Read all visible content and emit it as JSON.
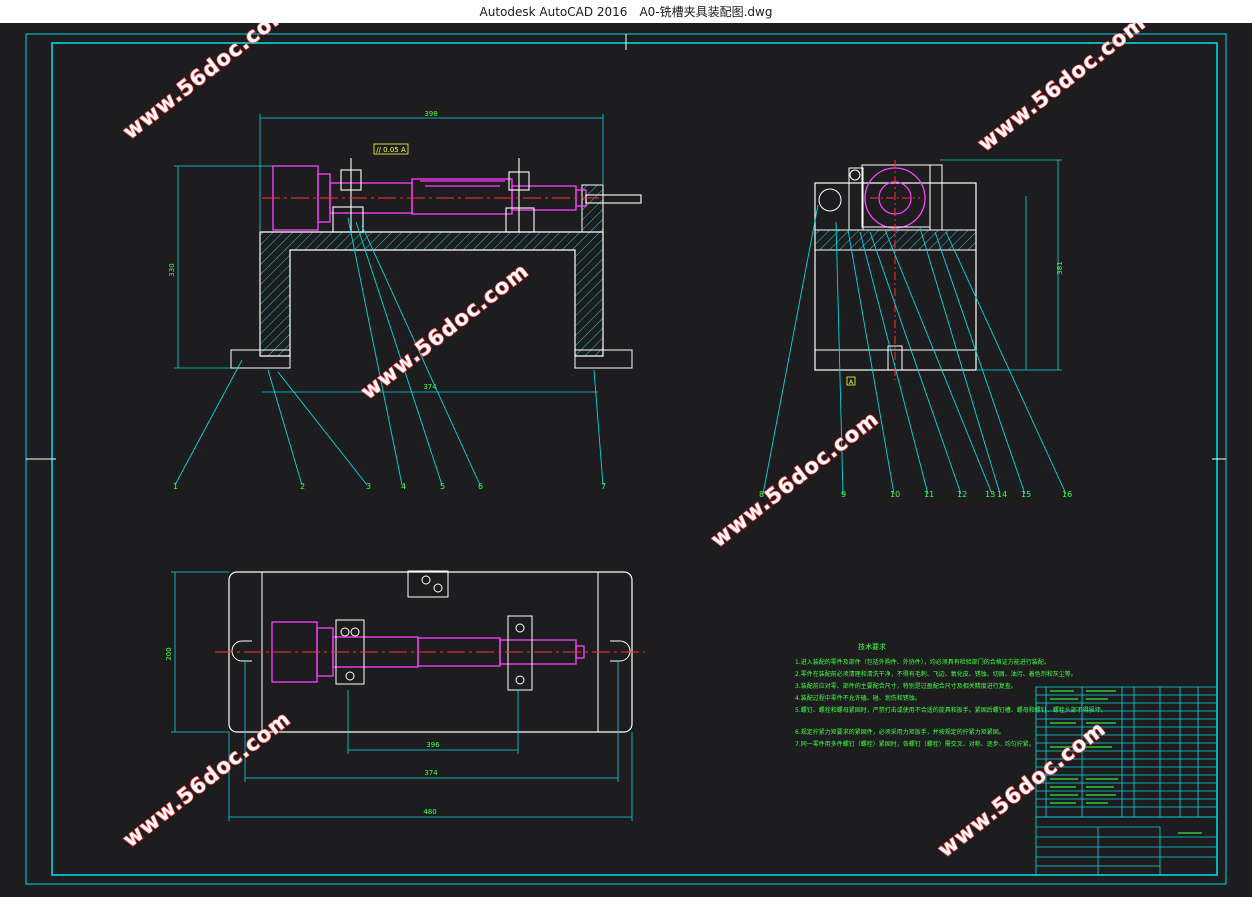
{
  "window": {
    "app_name": "Autodesk AutoCAD 2016",
    "file_name": "A0-铣槽夹具装配图.dwg"
  },
  "colors": {
    "frame": "#00d8e0",
    "part": "#ffffff",
    "workpiece": "#ff40ff",
    "centerline": "#ff3030",
    "hatch": "#22c7c7",
    "text": "#40ff40",
    "annotation": "#ffff40"
  },
  "drawing": {
    "front_view": {
      "dim_top": "398",
      "dim_height": "330",
      "dim_bottom": "374",
      "tolerance_box": "// 0.05 A",
      "callouts": [
        "1",
        "2",
        "3",
        "4",
        "5",
        "6",
        "7"
      ]
    },
    "side_view": {
      "dim_height": "381",
      "datum": "A",
      "callouts": [
        "8",
        "9",
        "10",
        "11",
        "12",
        "13",
        "14",
        "15",
        "16"
      ]
    },
    "top_view": {
      "dim_width_inner": "396",
      "dim_width_mid": "374",
      "dim_width_outer": "480",
      "dim_height": "200"
    },
    "notes": {
      "title": "技术要求",
      "lines": [
        "1.进入装配的零件及部件（包括外购件、外协件），均必须具有检验部门的合格证方能进行装配。",
        "2.零件在装配前必须清理和清洗干净，不得有毛刺、飞边、氧化皮、锈蚀、切屑、油污、着色剂和灰尘等。",
        "3.装配前应对零、部件的主要配合尺寸，特别是过盈配合尺寸及相关精度进行复查。",
        "4.装配过程中零件不允许磕、碰、划伤和锈蚀。",
        "5.螺钉、螺栓和螺母紧固时，严禁打击或使用不合适的旋具和扳手。紧固后螺钉槽、螺母和螺钉、螺栓头部不得损坏。",
        "6.规定拧紧力矩要求的紧固件，必须采用力矩扳手，并按规定的拧紧力矩紧固。",
        "7.同一零件用多件螺钉（螺栓）紧固时，各螺钉（螺栓）需交叉、对称、逐步、均匀拧紧。"
      ]
    }
  },
  "watermarks": [
    "www.56doc.com",
    "www.56doc.com",
    "www.56doc.com",
    "www.56doc.com",
    "www.56doc.com",
    "www.56doc.com"
  ]
}
